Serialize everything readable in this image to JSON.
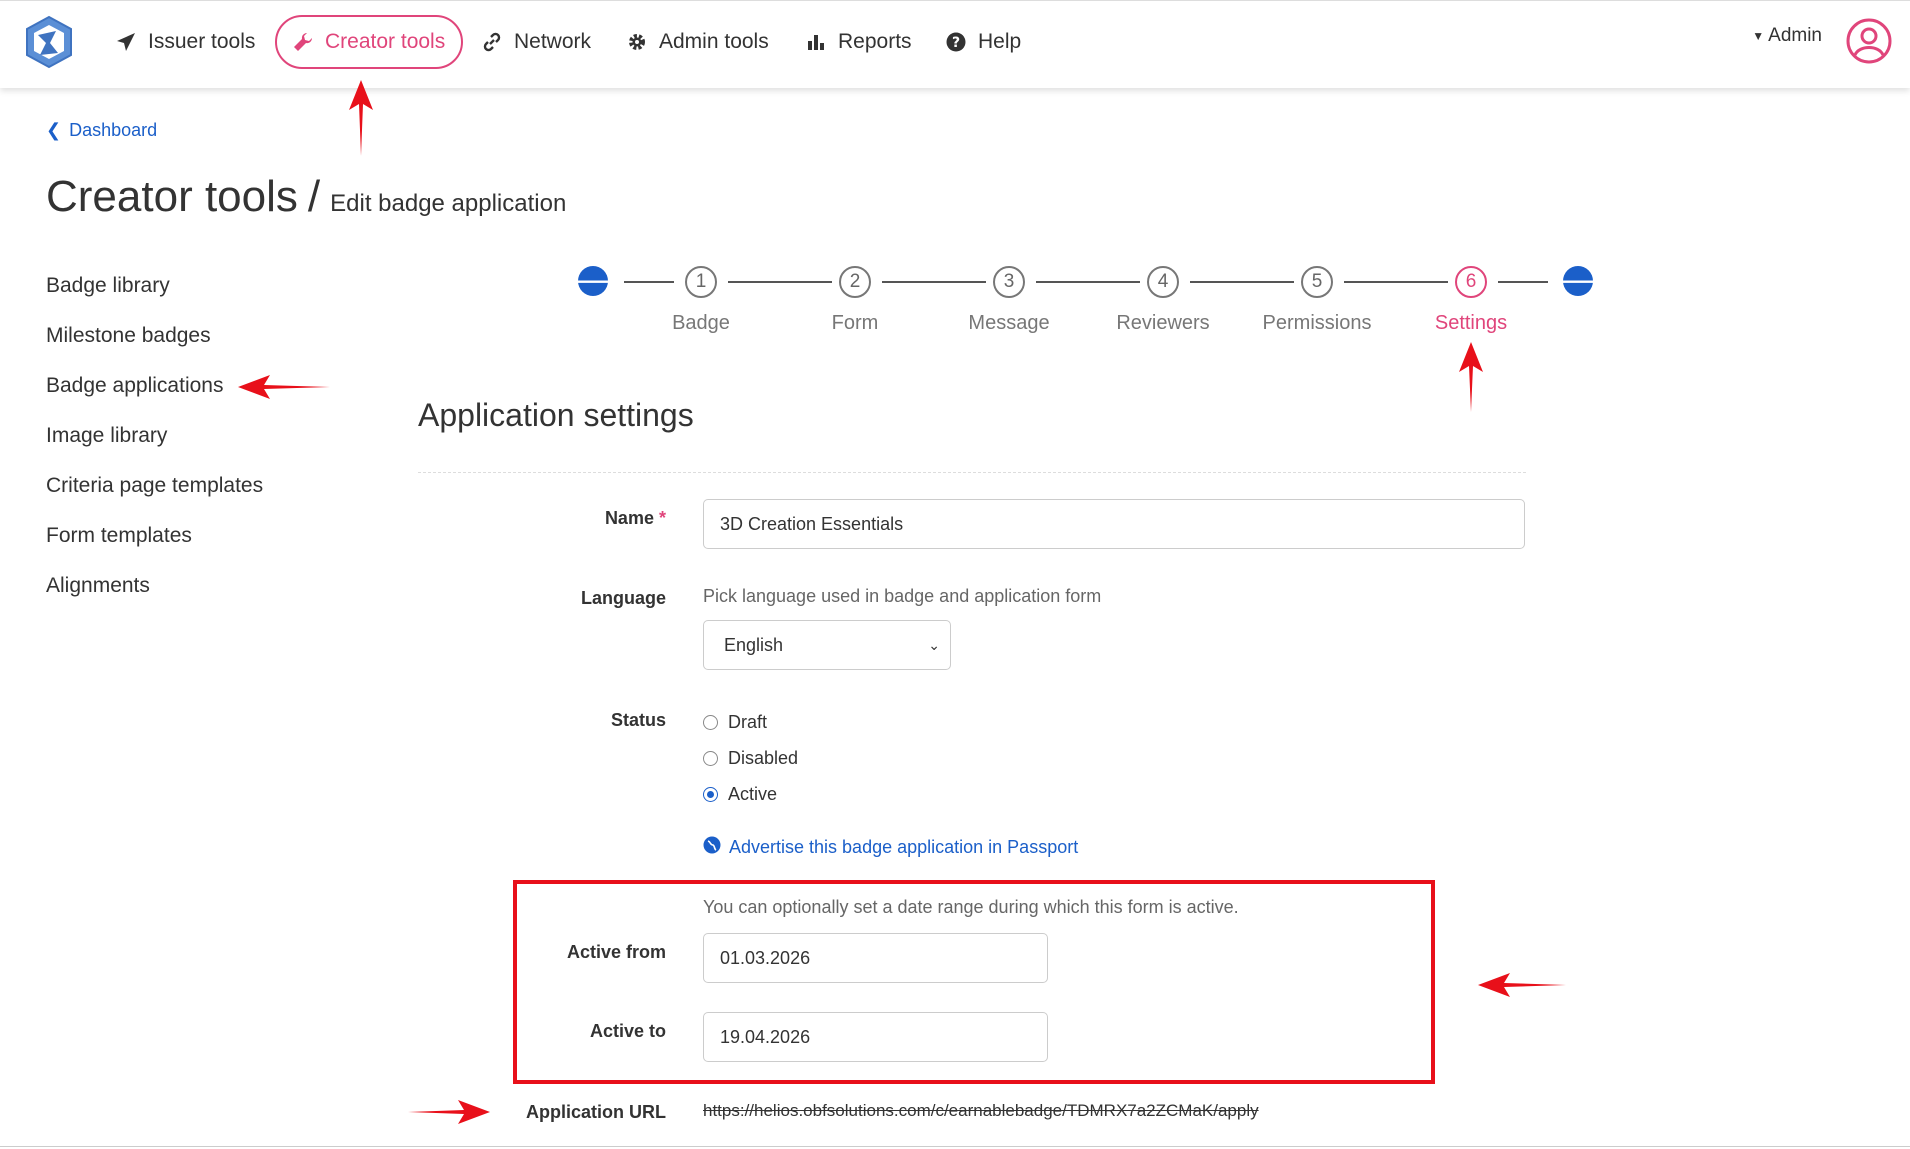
{
  "nav": {
    "items": [
      {
        "label": "Issuer tools",
        "icon": "paper-plane-icon"
      },
      {
        "label": "Creator tools",
        "icon": "wrench-icon",
        "active": true
      },
      {
        "label": "Network",
        "icon": "link-icon"
      },
      {
        "label": "Admin tools",
        "icon": "gear-icon"
      },
      {
        "label": "Reports",
        "icon": "bar-chart-icon"
      },
      {
        "label": "Help",
        "icon": "question-circle-icon"
      }
    ],
    "admin_label": "Admin"
  },
  "breadcrumb": {
    "back_label": "Dashboard"
  },
  "page": {
    "title": "Creator tools",
    "separator": "/",
    "subtitle": "Edit badge application"
  },
  "sidebar": {
    "items": [
      {
        "label": "Badge library"
      },
      {
        "label": "Milestone badges"
      },
      {
        "label": "Badge applications"
      },
      {
        "label": "Image library"
      },
      {
        "label": "Criteria page templates"
      },
      {
        "label": "Form templates"
      },
      {
        "label": "Alignments"
      }
    ]
  },
  "stepper": {
    "steps": [
      {
        "num": "1",
        "label": "Badge"
      },
      {
        "num": "2",
        "label": "Form"
      },
      {
        "num": "3",
        "label": "Message"
      },
      {
        "num": "4",
        "label": "Reviewers"
      },
      {
        "num": "5",
        "label": "Permissions"
      },
      {
        "num": "6",
        "label": "Settings",
        "current": true
      }
    ]
  },
  "form": {
    "section_title": "Application settings",
    "name_label": "Name",
    "name_required": "*",
    "name_value": "3D Creation Essentials",
    "language_label": "Language",
    "language_help": "Pick language used in badge and application form",
    "language_value": "English",
    "status_label": "Status",
    "status_options": [
      {
        "label": "Draft",
        "selected": false
      },
      {
        "label": "Disabled",
        "selected": false
      },
      {
        "label": "Active",
        "selected": true
      }
    ],
    "advertise_label": "Advertise this badge application in Passport",
    "date_help": "You can optionally set a date range during which this form is active.",
    "active_from_label": "Active from",
    "active_from_value": "01.03.2026",
    "active_to_label": "Active to",
    "active_to_value": "19.04.2026",
    "url_label": "Application URL",
    "url_value": "https://helios.obfsolutions.com/c/earnablebadge/TDMRX7a2ZCMaK/apply"
  },
  "colors": {
    "accent_pink": "#e0457b",
    "link_blue": "#1b5fc9",
    "annotation_red": "#e8101a"
  }
}
